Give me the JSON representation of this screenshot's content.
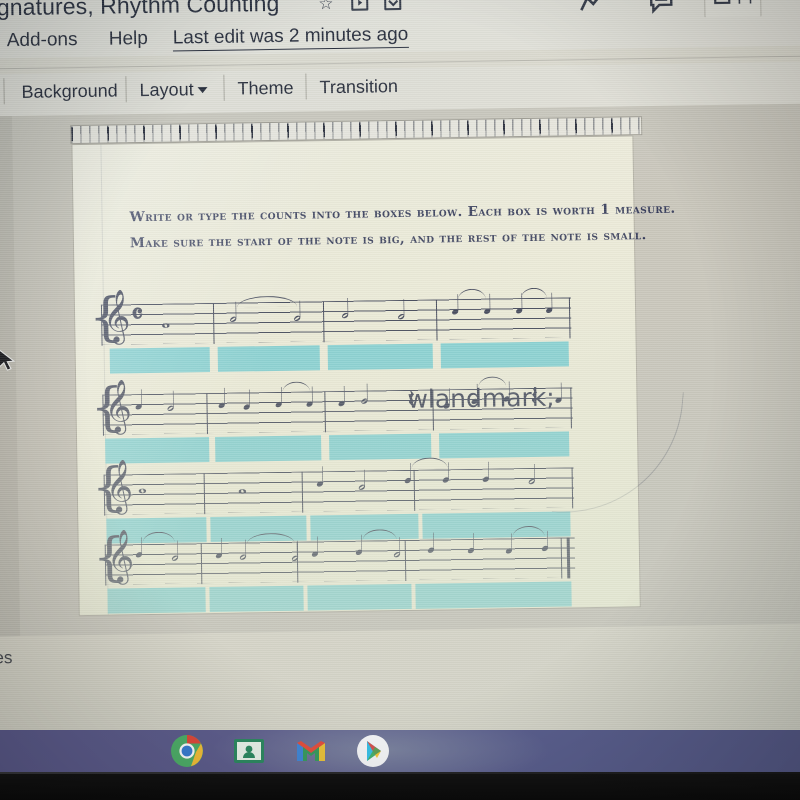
{
  "app": {
    "doc_title": "Signatures, Rhythm Counting",
    "title_icons": [
      "star-icon",
      "move-to-folder-icon",
      "cloud-status-icon"
    ],
    "last_edit": "Last edit was 2 minutes ago",
    "menu_items": [
      "Add-ons",
      "Help"
    ],
    "menu_left_partial": "]",
    "toolbar": {
      "left_partial": "]",
      "background_label": "Background",
      "layout_label": "Layout",
      "theme_label": "Theme",
      "transition_label": "Transition"
    },
    "right_icons": {
      "activity": "activity-chart-icon",
      "comment": "comment-icon",
      "present_label": "Pr",
      "present_icon": "present-play-icon"
    },
    "sidebar_partial_text": "es"
  },
  "slide": {
    "instructions": [
      "Write or type the counts into the boxes below. Each box is worth 1 measure.",
      "Make sure the start of the note is big, and the rest of the note is small."
    ],
    "answer_box_color": "#74cdd6",
    "systems": [
      {
        "id": "system-1",
        "clef": "treble-clef",
        "time_signature": "4/4",
        "measures": [
          {
            "notes": [
              "whole"
            ],
            "ties": []
          },
          {
            "notes": [
              "half",
              "half"
            ],
            "ties": [
              "1-2"
            ]
          },
          {
            "notes": [
              "half",
              "half"
            ],
            "ties": []
          },
          {
            "notes": [
              "quarter",
              "quarter",
              "quarter",
              "quarter"
            ],
            "ties": [
              "1-2",
              "3-4"
            ]
          }
        ]
      },
      {
        "id": "system-2",
        "clef": "treble-clef",
        "measures": [
          {
            "notes": [
              "quarter",
              "half",
              "quarter"
            ],
            "ties": []
          },
          {
            "notes": [
              "quarter",
              "quarter",
              "quarter",
              "quarter"
            ],
            "ties": [
              "2-3"
            ]
          },
          {
            "notes": [
              "half",
              "quarter-rest",
              "quarter"
            ],
            "ties": []
          },
          {
            "notes": [
              "quarter",
              "quarter",
              "quarter-rest",
              "quarter"
            ],
            "ties": [
              "1-2"
            ]
          }
        ]
      },
      {
        "id": "system-3",
        "clef": "treble-clef",
        "measures": [
          {
            "notes": [
              "whole"
            ],
            "ties": []
          },
          {
            "notes": [
              "whole"
            ],
            "ties": []
          },
          {
            "notes": [
              "quarter",
              "half",
              "quarter"
            ],
            "ties": [
              "3-4"
            ]
          },
          {
            "notes": [
              "quarter",
              "quarter",
              "half"
            ],
            "ties": []
          }
        ]
      },
      {
        "id": "system-4",
        "clef": "treble-clef",
        "final_barline": true,
        "measures": [
          {
            "notes": [
              "quarter",
              "half",
              "quarter"
            ],
            "ties": [
              "1-2"
            ]
          },
          {
            "notes": [
              "half",
              "half"
            ],
            "ties": [
              "1-2"
            ]
          },
          {
            "notes": [
              "quarter",
              "quarter",
              "half"
            ],
            "ties": [
              "2-3"
            ]
          },
          {
            "notes": [
              "quarter",
              "quarter",
              "quarter",
              "quarter"
            ],
            "ties": [
              "3-4"
            ]
          }
        ]
      }
    ]
  },
  "shelf": {
    "apps": [
      {
        "name": "chrome-app-icon",
        "label": "Chrome"
      },
      {
        "name": "classroom-app-icon",
        "label": "Google Classroom"
      },
      {
        "name": "gmail-app-icon",
        "label": "Gmail"
      },
      {
        "name": "play-store-app-icon",
        "label": "Play Store"
      }
    ]
  },
  "glyphs": {
    "treble_clef": "𝄞",
    "whole_note": "𝅝",
    "half_note": "𝅗𝅥",
    "quarter_note": "𝅘𝅥",
    "quarter_rest": "𝄽",
    "brace": "{",
    "star": "☆"
  }
}
